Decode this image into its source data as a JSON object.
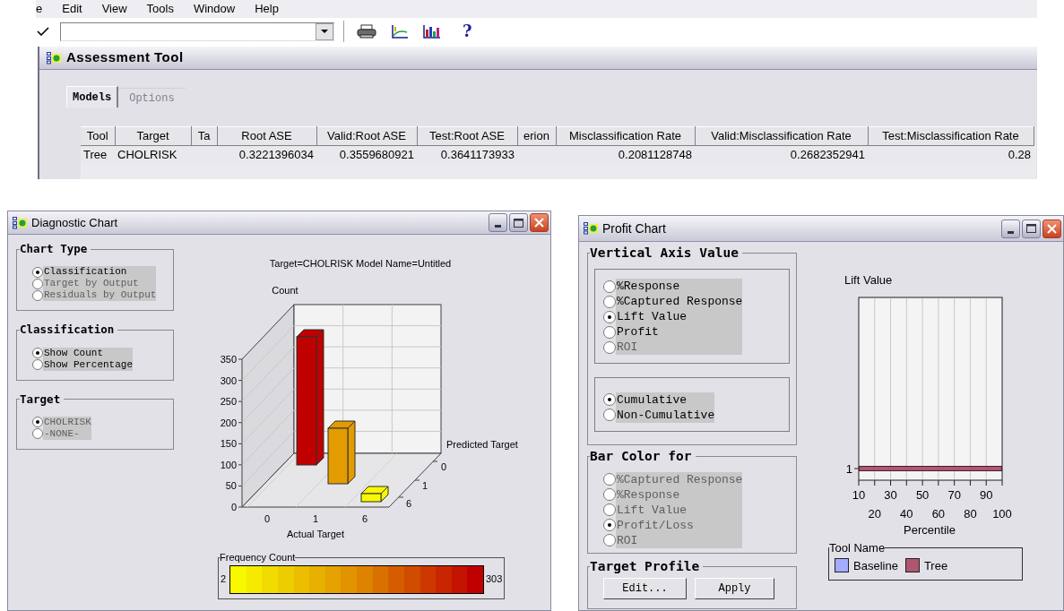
{
  "menu_bar": {
    "items": [
      "e",
      "Edit",
      "View",
      "Tools",
      "Window",
      "Help"
    ]
  },
  "toolbar": {
    "buttons": [
      {
        "kind": "print"
      },
      {
        "kind": "line-chart"
      },
      {
        "kind": "bar-chart"
      },
      {
        "kind": "help",
        "label": "?"
      }
    ]
  },
  "assessment_window": {
    "title": "Assessment Tool",
    "tabs": [
      {
        "label": "Models",
        "selected": true
      },
      {
        "label": "Options",
        "selected": false
      }
    ],
    "table": {
      "columns": [
        "Tool",
        "Target",
        "Ta",
        "Root ASE",
        "Valid:Root ASE",
        "Test:Root ASE",
        "erion",
        "Misclassification Rate",
        "Valid:Misclassification Rate",
        "Test:Misclassification Rate"
      ],
      "rows": [
        {
          "cells": [
            "Tree",
            "CHOLRISK",
            null,
            "0.3221396034",
            "0.3559680921",
            "0.3641173933",
            null,
            "0.2081128748",
            "0.2682352941",
            "0.28"
          ]
        }
      ]
    }
  },
  "diagnostic_window": {
    "title": "Diagnostic Chart",
    "groups": [
      {
        "title": "Chart Type",
        "options": [
          {
            "label": "Classification",
            "selected": true,
            "disabled": false
          },
          {
            "label": "Target by Output",
            "selected": false,
            "disabled": true
          },
          {
            "label": "Residuals by Output",
            "selected": false,
            "disabled": true
          }
        ]
      },
      {
        "title": "Classification",
        "options": [
          {
            "label": "Show Count",
            "selected": true,
            "disabled": false
          },
          {
            "label": "Show Percentage",
            "selected": false,
            "disabled": false
          }
        ]
      },
      {
        "title": "Target",
        "options": [
          {
            "label": "CHOLRISK",
            "selected": true,
            "disabled": true
          },
          {
            "label": "-NONE-",
            "selected": false,
            "disabled": true
          }
        ]
      }
    ],
    "chart": {
      "title": "Target=CHOLRISK Model Name=Untitled",
      "y_label": "Count",
      "y_ticks": [
        "350",
        "300",
        "250",
        "200",
        "150",
        "100",
        "50",
        "0"
      ],
      "x_label": "Actual Target",
      "x_ticks": [
        "0",
        "1",
        "6"
      ],
      "depth_label": "Predicted Target",
      "depth_ticks": [
        "0",
        "1",
        "6"
      ],
      "color_scale": {
        "title": "Frequency Count",
        "min": "2",
        "max": "303"
      }
    }
  },
  "profit_window": {
    "title": "Profit Chart",
    "axis_group": {
      "title": "Vertical Axis Value",
      "sets": [
        [
          {
            "label": "%Response",
            "selected": false,
            "disabled": false
          },
          {
            "label": "%Captured Response",
            "selected": false,
            "disabled": false
          },
          {
            "label": "Lift Value",
            "selected": true,
            "disabled": false
          },
          {
            "label": "Profit",
            "selected": false,
            "disabled": false
          },
          {
            "label": "ROI",
            "selected": false,
            "disabled": true
          }
        ],
        [
          {
            "label": "Cumulative",
            "selected": true,
            "disabled": false
          },
          {
            "label": "Non-Cumulative",
            "selected": false,
            "disabled": false
          }
        ]
      ]
    },
    "bar_color_group": {
      "title": "Bar Color for",
      "options": [
        {
          "label": "%Captured Response",
          "selected": false,
          "disabled": true
        },
        {
          "label": "%Response",
          "selected": false,
          "disabled": true
        },
        {
          "label": "Lift Value",
          "selected": false,
          "disabled": true
        },
        {
          "label": "Profit/Loss",
          "selected": true,
          "disabled": true
        },
        {
          "label": "ROI",
          "selected": false,
          "disabled": true
        }
      ]
    },
    "target_profile": {
      "title": "Target Profile",
      "buttons": [
        "Edit...",
        "Apply"
      ]
    },
    "chart": {
      "y_label": "Lift Value",
      "y_ticks": [
        "1"
      ],
      "x_label": "Percentile",
      "x_ticks": [
        "10",
        "20",
        "30",
        "40",
        "50",
        "60",
        "70",
        "80",
        "90",
        "100"
      ],
      "legend": {
        "title": "Tool Name",
        "items": [
          {
            "name": "Baseline",
            "color": "#a4acff"
          },
          {
            "name": "Tree",
            "color": "#b0566e"
          }
        ]
      }
    }
  }
}
